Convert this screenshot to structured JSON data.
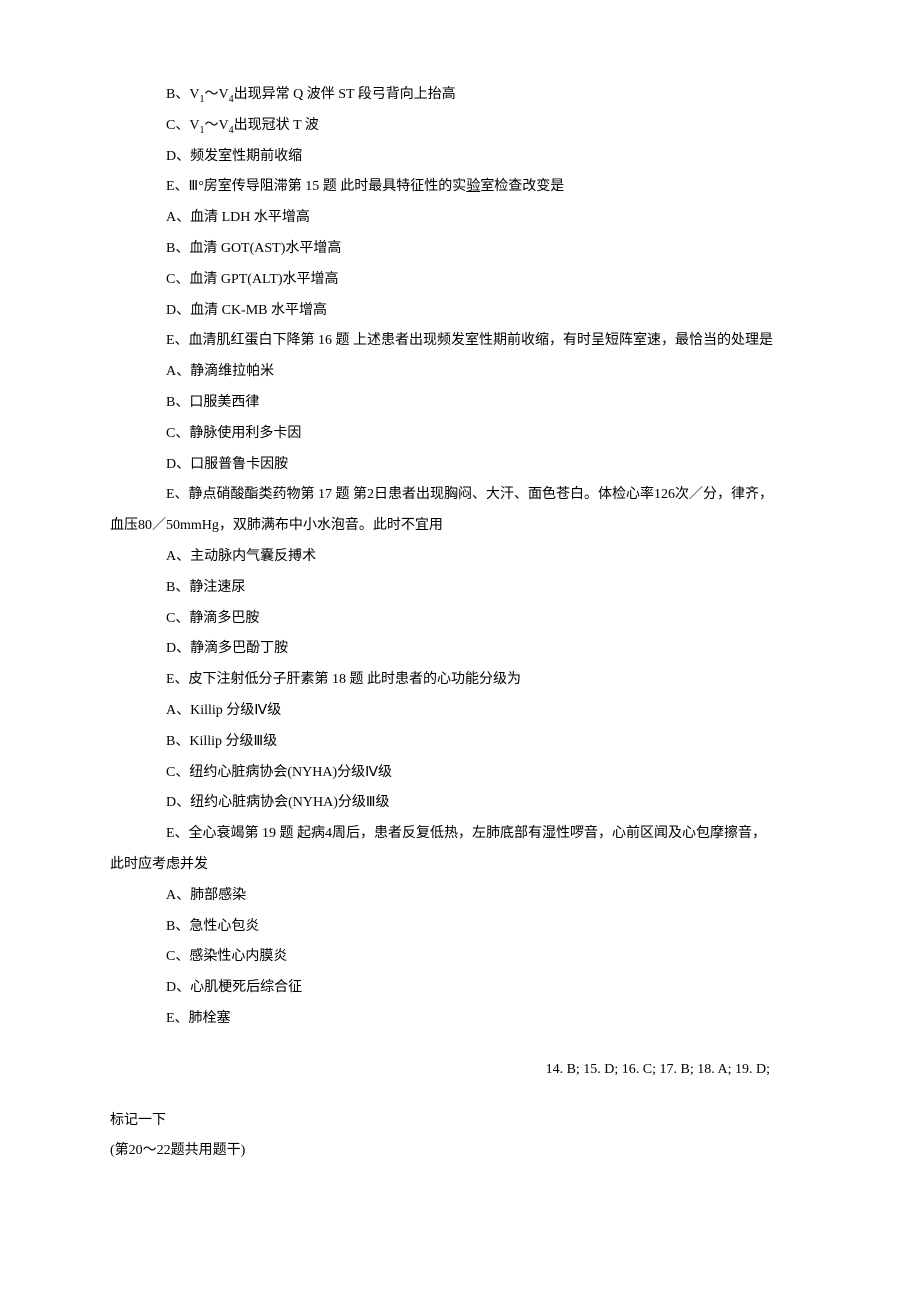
{
  "lines": {
    "b": "B、V",
    "b_sub": "1",
    "b_mid": "～V",
    "b_sub2": "4",
    "b_end": "出现异常 Q 波伴 ST 段弓背向上抬高",
    "c": "C、V",
    "c_sub": "1",
    "c_mid": "～V",
    "c_sub2": "4",
    "c_end": "出现冠状 T 波",
    "d": "D、频发室性期前收缩",
    "e": "E、Ⅲ°房室传导阻滞第 15 题 此时最具特征性的实",
    "e_ul": "验",
    "e_end": "室检查改变是",
    "q15a": "A、血清 LDH 水平增高",
    "q15b": "B、血清 GOT(AST)水平增高",
    "q15c": "C、血清 GPT(ALT)水平增高",
    "q15d": "D、血清 CK-MB 水平增高",
    "q15e": "E、血清肌红蛋白下降第 16 题 上述患者出现频发室性期前收缩，有时呈短阵室速，最恰当的处理是",
    "q16a": "A、静滴维拉帕米",
    "q16b": "B、口服美西律",
    "q16c": "C、静脉使用利多卡因",
    "q16d": "D、口服普鲁卡因胺",
    "q16e": "E、静点硝酸酯类药物第 17 题 第2日患者出现胸闷、大汗、面色苍白。体检心率126次／分，律齐，",
    "q16e_cont": "血压80／50mmHg，双肺满布中小水泡音。此时不宜用",
    "q17a": "A、主动脉内气囊反搏术",
    "q17b": "B、静注速尿",
    "q17c": "C、静滴多巴胺",
    "q17d": "D、静滴多巴酚丁胺",
    "q17e": "E、皮下注射低分子肝素第 18 题 此时患者的心功能分级为",
    "q18a": "A、Killip 分级Ⅳ级",
    "q18b": "B、Killip 分级Ⅲ级",
    "q18c": "C、纽约心脏病协会(NYHA)分级Ⅳ级",
    "q18d": "D、纽约心脏病协会(NYHA)分级Ⅲ级",
    "q18e": "E、全心衰竭第 19 题 起病4周后，患者反复低热，左肺底部有湿性啰音，心前区闻及心包摩擦音，",
    "q18e_cont": "此时应考虑并发",
    "q19a": "A、肺部感染",
    "q19b": "B、急性心包炎",
    "q19c": "C、感染性心内膜炎",
    "q19d": "D、心肌梗死后综合征",
    "q19e": "E、肺栓塞"
  },
  "answers": "14. B; 15. D; 16. C; 17. B; 18. A; 19. D;",
  "footer": {
    "mark": "标记一下",
    "group": "(第20～22题共用题干)"
  }
}
